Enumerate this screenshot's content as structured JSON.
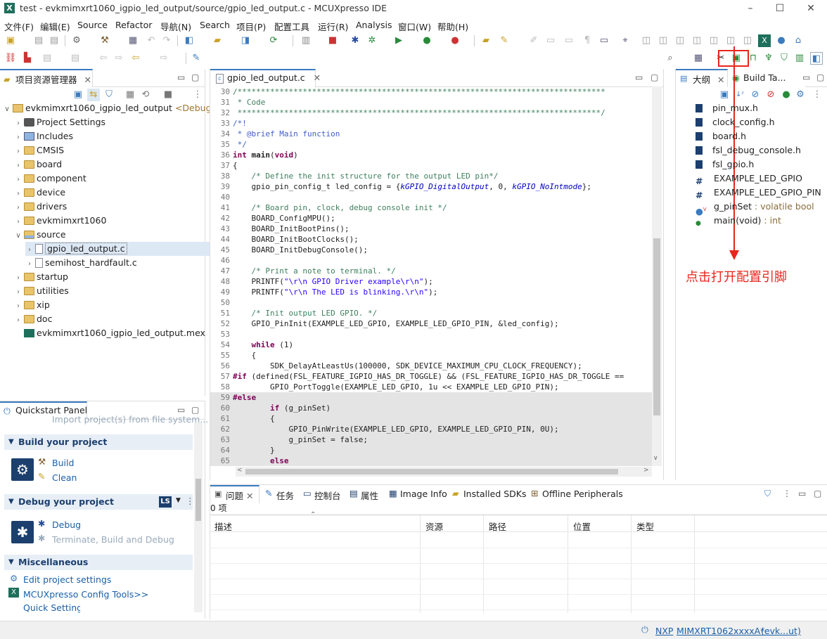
{
  "window": {
    "title": "test - evkmimxrt1060_igpio_led_output/source/gpio_led_output.c - MCUXpresso IDE",
    "logo": "X"
  },
  "menu": [
    "文件(F)",
    "编辑(E)",
    "Source",
    "Refactor",
    "导航(N)",
    "Search",
    "项目(P)",
    "配置工具",
    "运行(R)",
    "Analysis",
    "窗口(W)",
    "帮助(H)"
  ],
  "project_explorer": {
    "tab": "项目资源管理器",
    "root": {
      "label": "evkmimxrt1060_igpio_led_output",
      "tag": "<Debug>"
    },
    "items": [
      {
        "label": "Project Settings",
        "icon": "settings-icon"
      },
      {
        "label": "Includes",
        "icon": "includes-icon"
      },
      {
        "label": "CMSIS",
        "icon": "folder-icon"
      },
      {
        "label": "board",
        "icon": "folder-icon"
      },
      {
        "label": "component",
        "icon": "folder-icon"
      },
      {
        "label": "device",
        "icon": "folder-icon"
      },
      {
        "label": "drivers",
        "icon": "folder-icon"
      },
      {
        "label": "evkmimxrt1060",
        "icon": "folder-icon"
      },
      {
        "label": "source",
        "icon": "folder-icon"
      },
      {
        "label": "gpio_led_output.c",
        "icon": "c-file-icon"
      },
      {
        "label": "semihost_hardfault.c",
        "icon": "c-file-icon"
      },
      {
        "label": "startup",
        "icon": "folder-icon"
      },
      {
        "label": "utilities",
        "icon": "folder-icon"
      },
      {
        "label": "xip",
        "icon": "folder-icon"
      },
      {
        "label": "doc",
        "icon": "folder-icon"
      },
      {
        "label": "evkmimxrt1060_igpio_led_output.mex",
        "icon": "mex-file-icon"
      }
    ]
  },
  "quickstart": {
    "tab": "Quickstart Panel",
    "partial": "Import project(s) from file system...",
    "sections": [
      {
        "title": "Build your project",
        "links": [
          "Build",
          "Clean"
        ]
      },
      {
        "title": "Debug your project",
        "links": [
          "Debug",
          "Terminate, Build and Debug"
        ]
      },
      {
        "title": "Miscellaneous",
        "links": [
          "Edit project settings",
          "MCUXpresso Config Tools>>",
          "Quick Settings>>"
        ]
      }
    ],
    "ls_badge": "LS"
  },
  "editor": {
    "tab": "gpio_led_output.c",
    "lines": [
      {
        "n": "30",
        "fold": "⊖",
        "t": "/*******************************************************************************",
        "c": "cmg"
      },
      {
        "n": "31",
        "t": " * Code",
        "c": "cmg"
      },
      {
        "n": "32",
        "t": " ******************************************************************************/",
        "c": "cmg"
      },
      {
        "n": "33",
        "fold": "⊖",
        "t": "/*!",
        "c": "cm"
      },
      {
        "n": "34",
        "t": " * @brief Main function",
        "c": "cm"
      },
      {
        "n": "35",
        "t": " */",
        "c": "cm"
      },
      {
        "n": "36",
        "fold": "⊖",
        "t": "",
        "c": "",
        "html": "<span class='kw'>int</span> <b>main</b>(<span class='kw'>void</span>)"
      },
      {
        "n": "37",
        "t": "{",
        "c": ""
      },
      {
        "n": "38",
        "t": "    /* Define the init structure for the output LED pin*/",
        "c": "cmg"
      },
      {
        "n": "39",
        "t": "",
        "c": "",
        "html": "    gpio_pin_config_t led_config = {<span class='en'>kGPIO_DigitalOutput</span>, 0, <span class='en'>kGPIO_NoIntmode</span>};"
      },
      {
        "n": "40",
        "t": "",
        "c": ""
      },
      {
        "n": "41",
        "t": "    /* Board pin, clock, debug console init */",
        "c": "cmg"
      },
      {
        "n": "42",
        "t": "    BOARD_ConfigMPU();",
        "c": ""
      },
      {
        "n": "43",
        "t": "    BOARD_InitBootPins();",
        "c": ""
      },
      {
        "n": "44",
        "t": "    BOARD_InitBootClocks();",
        "c": ""
      },
      {
        "n": "45",
        "t": "    BOARD_InitDebugConsole();",
        "c": ""
      },
      {
        "n": "46",
        "t": "",
        "c": ""
      },
      {
        "n": "47",
        "t": "    /* Print a note to terminal. */",
        "c": "cmg"
      },
      {
        "n": "48",
        "t": "",
        "c": "",
        "html": "    PRINTF(<span class='st'>\"\\r\\n GPIO Driver example\\r\\n\"</span>);"
      },
      {
        "n": "49",
        "t": "",
        "c": "",
        "html": "    PRINTF(<span class='st'>\"\\r\\n The LED is blinking.\\r\\n\"</span>);"
      },
      {
        "n": "50",
        "t": "",
        "c": ""
      },
      {
        "n": "51",
        "t": "    /* Init output LED GPIO. */",
        "c": "cmg"
      },
      {
        "n": "52",
        "t": "    GPIO_PinInit(EXAMPLE_LED_GPIO, EXAMPLE_LED_GPIO_PIN, &led_config);",
        "c": ""
      },
      {
        "n": "53",
        "t": "",
        "c": ""
      },
      {
        "n": "54",
        "t": "",
        "c": "",
        "html": "    <span class='kw'>while</span> (1)"
      },
      {
        "n": "55",
        "t": "    {",
        "c": ""
      },
      {
        "n": "56",
        "t": "        SDK_DelayAtLeastUs(100000, SDK_DEVICE_MAXIMUM_CPU_CLOCK_FREQUENCY);",
        "c": ""
      },
      {
        "n": "57",
        "t": "",
        "c": "",
        "html": "<span class='pp'>#if</span> (defined(FSL_FEATURE_IGPIO_HAS_DR_TOGGLE) && (FSL_FEATURE_IGPIO_HAS_DR_TOGGLE =="
      },
      {
        "n": "58",
        "t": "        GPIO_PortToggle(EXAMPLE_LED_GPIO, 1u << EXAMPLE_LED_GPIO_PIN);",
        "c": ""
      },
      {
        "n": "59",
        "t": "",
        "c": "",
        "html": "<span class='pp'>#else</span>",
        "shade": true
      },
      {
        "n": "60",
        "t": "",
        "c": "",
        "html": "        <span class='kw'>if</span> (g_pinSet)",
        "shade": true
      },
      {
        "n": "61",
        "t": "        {",
        "c": "",
        "shade": true
      },
      {
        "n": "62",
        "t": "            GPIO_PinWrite(EXAMPLE_LED_GPIO, EXAMPLE_LED_GPIO_PIN, 0U);",
        "c": "",
        "shade": true
      },
      {
        "n": "63",
        "t": "            g_pinSet = false;",
        "c": "",
        "shade": true
      },
      {
        "n": "64",
        "t": "        }",
        "c": "",
        "shade": true
      },
      {
        "n": "65",
        "t": "",
        "c": "",
        "html": "        <span class='kw'>else</span>",
        "shade": true
      }
    ]
  },
  "outline": {
    "tab": "大纲",
    "tab2": "Build Ta...",
    "items": [
      {
        "label": "pin_mux.h",
        "type": ""
      },
      {
        "label": "clock_config.h",
        "type": ""
      },
      {
        "label": "board.h",
        "type": ""
      },
      {
        "label": "fsl_debug_console.h",
        "type": ""
      },
      {
        "label": "fsl_gpio.h",
        "type": ""
      },
      {
        "label": "EXAMPLE_LED_GPIO",
        "type": ""
      },
      {
        "label": "EXAMPLE_LED_GPIO_PIN",
        "type": ""
      },
      {
        "label": "g_pinSet",
        "type": " : volatile bool"
      },
      {
        "label": "main(void)",
        "type": " : int"
      }
    ],
    "annotation": "点击打开配置引脚",
    "annotation_color": "#e8261c"
  },
  "problems": {
    "tabs": [
      "问题",
      "任务",
      "控制台",
      "属性",
      "Image Info",
      "Installed SDKs",
      "Offline Peripherals"
    ],
    "count": "0 项",
    "columns": [
      "描述",
      "资源",
      "路径",
      "位置",
      "类型"
    ]
  },
  "status": {
    "nxp": "NXP",
    "device": "MIMXRT1062xxxxA*",
    "project": "(evk...ut)"
  }
}
